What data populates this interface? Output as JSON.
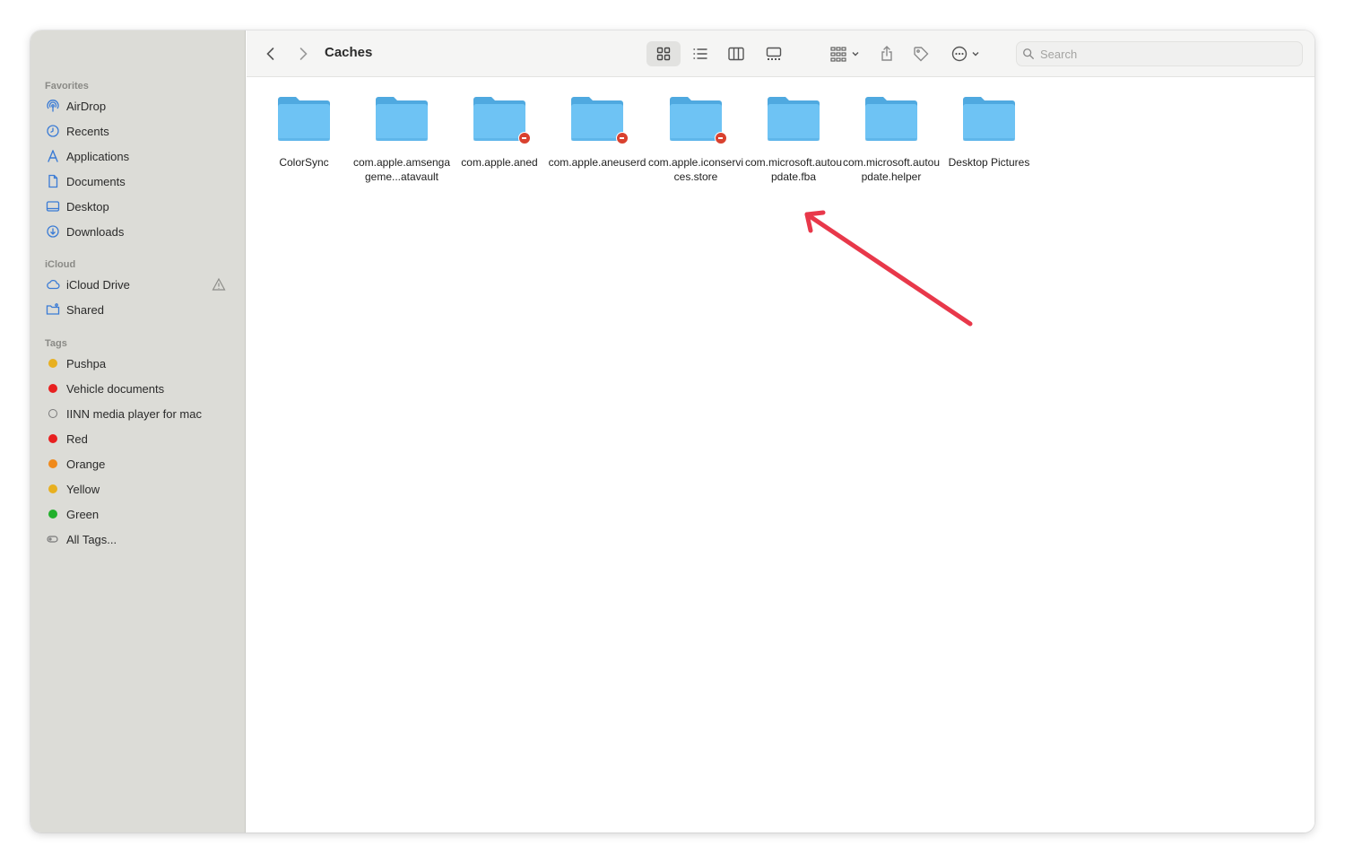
{
  "window": {
    "title": "Caches"
  },
  "sidebar": {
    "favorites_title": "Favorites",
    "favorites": [
      {
        "label": "AirDrop",
        "icon": "airdrop-icon"
      },
      {
        "label": "Recents",
        "icon": "clock-icon"
      },
      {
        "label": "Applications",
        "icon": "applications-icon"
      },
      {
        "label": "Documents",
        "icon": "document-icon"
      },
      {
        "label": "Desktop",
        "icon": "desktop-icon"
      },
      {
        "label": "Downloads",
        "icon": "download-icon"
      }
    ],
    "icloud_title": "iCloud",
    "icloud": [
      {
        "label": "iCloud Drive",
        "icon": "cloud-icon"
      },
      {
        "label": "Shared",
        "icon": "shared-folder-icon"
      }
    ],
    "tags_title": "Tags",
    "tags": [
      {
        "label": "Pushpa",
        "color": "#e8b020"
      },
      {
        "label": "Vehicle documents",
        "color": "#e82020"
      },
      {
        "label": "IINN media player for mac",
        "color": ""
      },
      {
        "label": "Red",
        "color": "#e82020"
      },
      {
        "label": "Orange",
        "color": "#f08a1c"
      },
      {
        "label": "Yellow",
        "color": "#e8b020"
      },
      {
        "label": "Green",
        "color": "#22b02c"
      },
      {
        "label": "All Tags...",
        "color": ""
      }
    ]
  },
  "search": {
    "placeholder": "Search"
  },
  "files": [
    {
      "name": "ColorSync",
      "badge": false
    },
    {
      "name": "com.apple.amsengageme...atavault",
      "badge": false
    },
    {
      "name": "com.apple.aned",
      "badge": true
    },
    {
      "name": "com.apple.aneuserd",
      "badge": true
    },
    {
      "name": "com.apple.iconservices.store",
      "badge": true
    },
    {
      "name": "com.microsoft.autoupdate.fba",
      "badge": false
    },
    {
      "name": "com.microsoft.autoupdate.helper",
      "badge": false
    },
    {
      "name": "Desktop Pictures",
      "badge": false
    }
  ],
  "colors": {
    "folder": "#6ec3f4",
    "folder_tab": "#4fa9e0",
    "annotation_arrow": "#e8384a"
  }
}
